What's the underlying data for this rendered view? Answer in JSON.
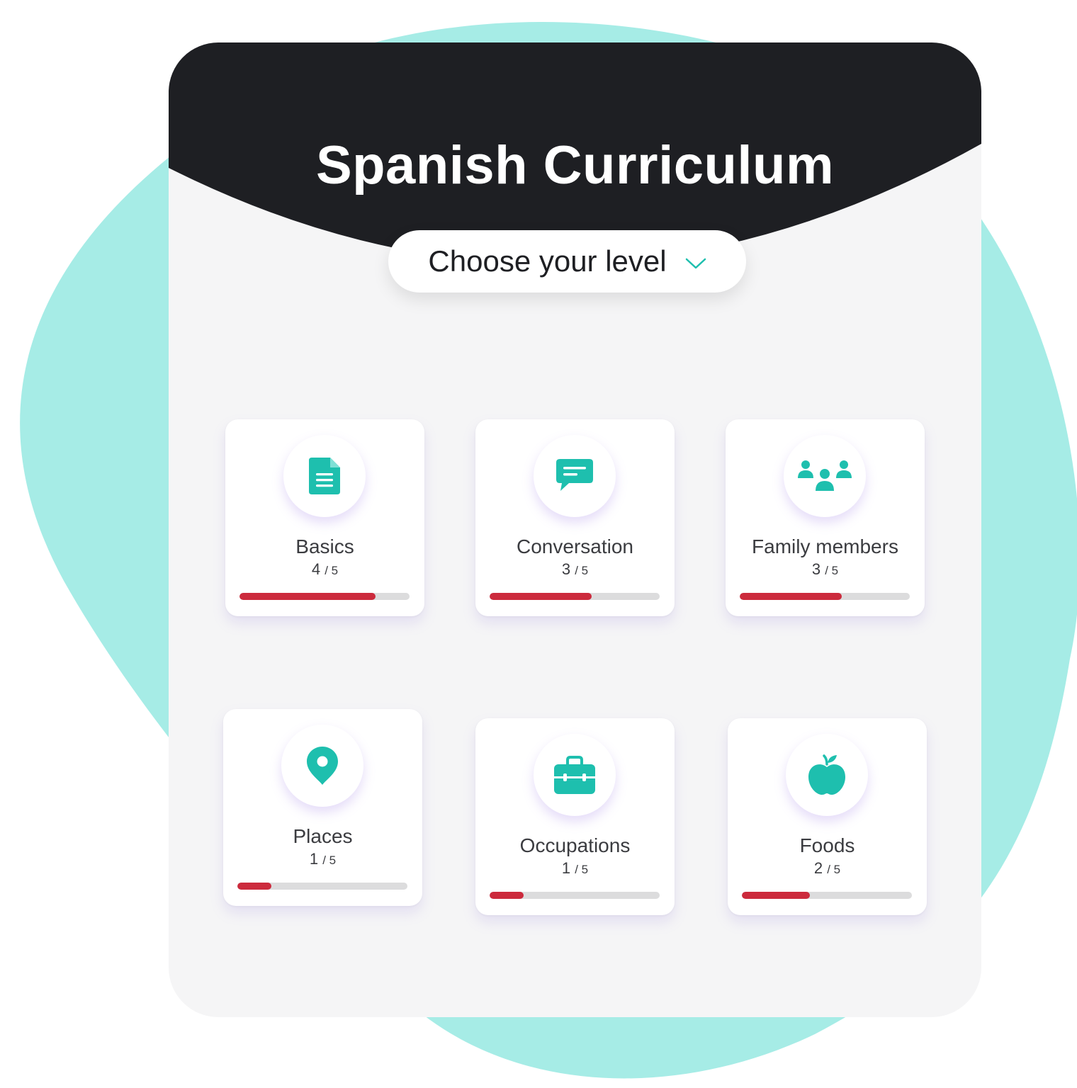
{
  "title": "Spanish Curriculum",
  "level_select": {
    "label": "Choose your level",
    "icon": "chevron-down-icon"
  },
  "colors": {
    "accent": "#1ebfae",
    "header": "#1e1f23",
    "progress_fill": "#cc2a3c",
    "progress_track": "#dcdcdd",
    "blob": "#a6ece6"
  },
  "topics": [
    {
      "name": "Basics",
      "completed": "4",
      "total": "5",
      "progress": 0.8,
      "icon": "document-icon"
    },
    {
      "name": "Conversation",
      "completed": "3",
      "total": "5",
      "progress": 0.6,
      "icon": "chat-icon"
    },
    {
      "name": "Family members",
      "completed": "3",
      "total": "5",
      "progress": 0.6,
      "icon": "people-icon"
    },
    {
      "name": "Places",
      "completed": "1",
      "total": "5",
      "progress": 0.2,
      "icon": "map-pin-icon"
    },
    {
      "name": "Occupations",
      "completed": "1",
      "total": "5",
      "progress": 0.2,
      "icon": "briefcase-icon"
    },
    {
      "name": "Foods",
      "completed": "2",
      "total": "5",
      "progress": 0.4,
      "icon": "apple-icon"
    }
  ]
}
